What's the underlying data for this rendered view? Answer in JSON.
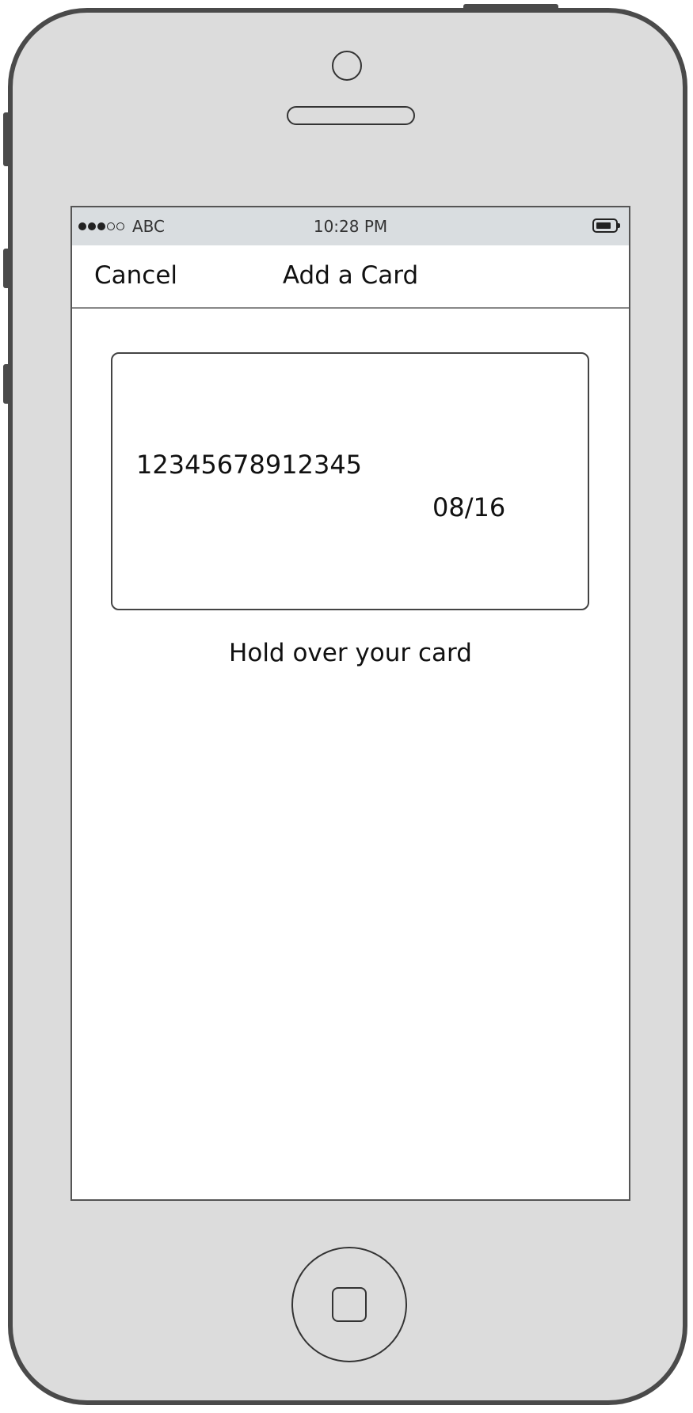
{
  "status_bar": {
    "carrier": "ABC",
    "time": "10:28 PM",
    "signal_strength": "3 of 5",
    "battery_icon": "battery-icon"
  },
  "nav": {
    "cancel_label": "Cancel",
    "title": "Add a Card"
  },
  "card": {
    "number": "12345678912345",
    "expiry": "08/16"
  },
  "instruction": "Hold over your card",
  "colors": {
    "device_body": "#dcdcdc",
    "device_outline": "#4a4a4a",
    "status_bar_bg": "#d9dde0",
    "screen_bg": "#ffffff"
  }
}
